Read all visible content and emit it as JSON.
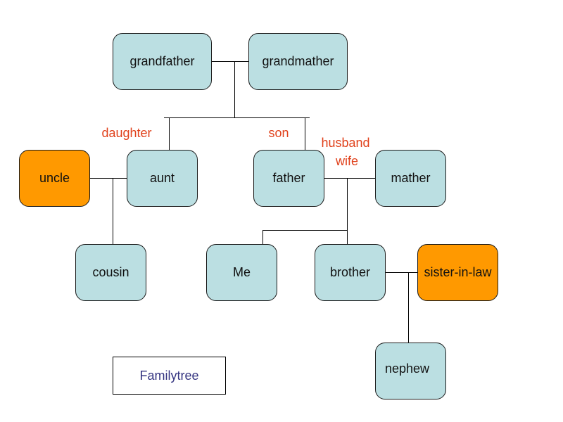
{
  "diagram": {
    "title": "Familytree",
    "colors": {
      "blood_relative": "#bbdfe2",
      "in_law": "#ff9900",
      "relation_label": "#e0401a",
      "title_text": "#333380"
    },
    "nodes": {
      "grandfather": "grandfather",
      "grandmather": "grandmather",
      "uncle": "uncle",
      "aunt": "aunt",
      "father": "father",
      "mather": "mather",
      "cousin": "cousin",
      "me": "Me",
      "brother": "brother",
      "sister_in_law": "sister-in-law",
      "nephew": "nephew"
    },
    "relation_labels": {
      "daughter": "daughter",
      "son": "son",
      "husband": "husband",
      "wife": "wife"
    }
  }
}
